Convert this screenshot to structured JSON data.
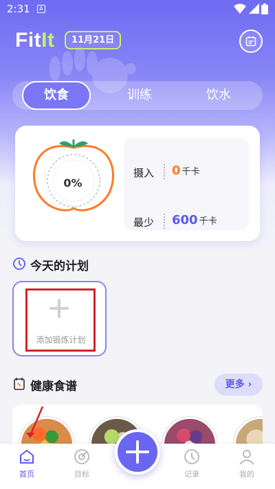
{
  "status_bar": {
    "time": "2:31",
    "sim_label": "A"
  },
  "header": {
    "logo_fit": "Fit",
    "logo_it": "It",
    "date": "11月21日"
  },
  "tabs": [
    {
      "label": "饮食",
      "active": true
    },
    {
      "label": "训练"
    },
    {
      "label": "饮水"
    }
  ],
  "summary": {
    "percent": "0%",
    "intake_label": "摄入",
    "intake_value": "0",
    "intake_unit": "千卡",
    "min_label": "最少",
    "min_value": "600",
    "min_unit": "千卡"
  },
  "plan_section": {
    "title": "今天的计划",
    "add_label": "添加锻炼计划"
  },
  "recipe_section": {
    "title": "健康食谱",
    "more_label": "更多 ›"
  },
  "bottom_nav": [
    {
      "label": "首页",
      "active": true
    },
    {
      "label": "目标"
    },
    {
      "label": "记录"
    },
    {
      "label": "我的"
    }
  ],
  "colors": {
    "brand": "#6a66f2",
    "accent_lime": "#c8f06a",
    "orange": "#ff7a22",
    "blue": "#5c59ee",
    "annotation_red": "#d0242a"
  }
}
